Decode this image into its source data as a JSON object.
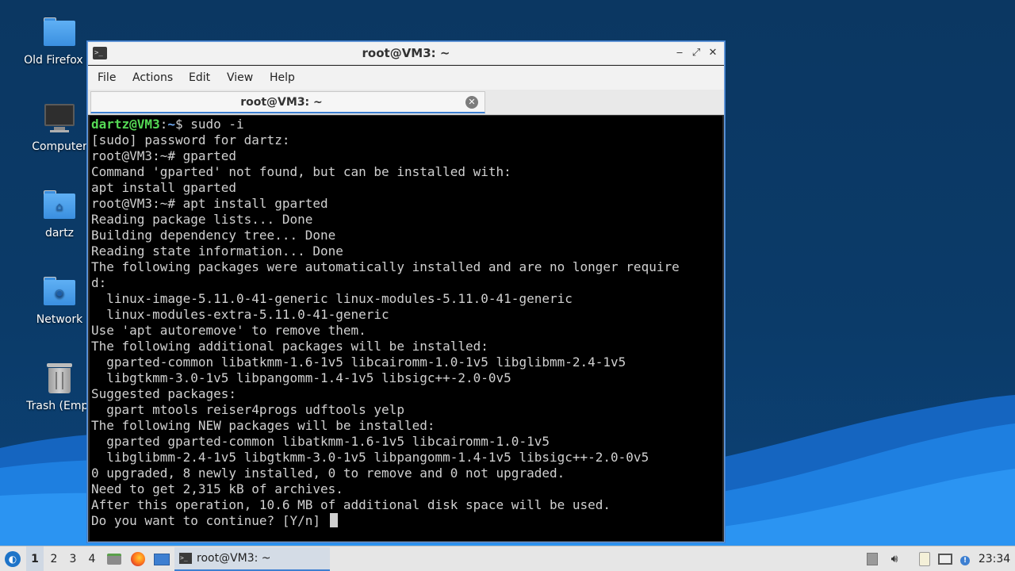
{
  "desktop": {
    "icons": [
      {
        "label": "Old Firefox D",
        "icon": "folder-icon"
      },
      {
        "label": "Computer",
        "icon": "computer-icon"
      },
      {
        "label": "dartz",
        "icon": "home-folder-icon"
      },
      {
        "label": "Network",
        "icon": "network-folder-icon"
      },
      {
        "label": "Trash (Empt",
        "icon": "trash-icon"
      }
    ]
  },
  "window": {
    "title": "root@VM3: ~",
    "menu": [
      "File",
      "Actions",
      "Edit",
      "View",
      "Help"
    ],
    "tab_label": "root@VM3: ~"
  },
  "terminal": {
    "line0": {
      "user": "dartz@VM3",
      "colon": ":",
      "path": "~",
      "rest": "$ sudo -i"
    },
    "lines": [
      "[sudo] password for dartz:",
      "root@VM3:~# gparted",
      "Command 'gparted' not found, but can be installed with:",
      "apt install gparted",
      "root@VM3:~# apt install gparted",
      "Reading package lists... Done",
      "Building dependency tree... Done",
      "Reading state information... Done",
      "The following packages were automatically installed and are no longer require",
      "d:",
      "  linux-image-5.11.0-41-generic linux-modules-5.11.0-41-generic",
      "  linux-modules-extra-5.11.0-41-generic",
      "Use 'apt autoremove' to remove them.",
      "The following additional packages will be installed:",
      "  gparted-common libatkmm-1.6-1v5 libcairomm-1.0-1v5 libglibmm-2.4-1v5",
      "  libgtkmm-3.0-1v5 libpangomm-1.4-1v5 libsigc++-2.0-0v5",
      "Suggested packages:",
      "  gpart mtools reiser4progs udftools yelp",
      "The following NEW packages will be installed:",
      "  gparted gparted-common libatkmm-1.6-1v5 libcairomm-1.0-1v5",
      "  libglibmm-2.4-1v5 libgtkmm-3.0-1v5 libpangomm-1.4-1v5 libsigc++-2.0-0v5",
      "0 upgraded, 8 newly installed, 0 to remove and 0 not upgraded.",
      "Need to get 2,315 kB of archives.",
      "After this operation, 10.6 MB of additional disk space will be used.",
      "Do you want to continue? [Y/n] "
    ]
  },
  "taskbar": {
    "workspaces": [
      "1",
      "2",
      "3",
      "4"
    ],
    "active_workspace": "1",
    "launchers": [
      "file-manager-icon",
      "firefox-icon",
      "desktop-icon"
    ],
    "task_label": "root@VM3: ~",
    "tray_icons": [
      "notification-icon",
      "volume-icon",
      "clipboard-icon",
      "network-icon",
      "update-icon"
    ],
    "clock": "23:34"
  },
  "colors": {
    "accent": "#3d7fd1",
    "prompt_user": "#55d955",
    "prompt_path": "#6fa8f0",
    "terminal_bg": "#000000"
  }
}
